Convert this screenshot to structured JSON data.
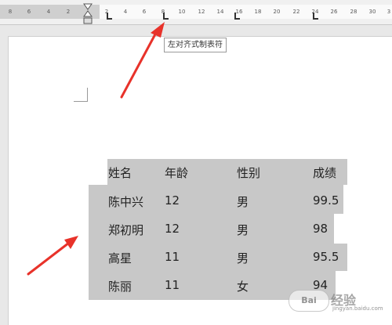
{
  "ruler": {
    "ticks": [
      "8",
      "6",
      "4",
      "2",
      "2",
      "4",
      "6",
      "8",
      "10",
      "12",
      "14",
      "16",
      "18",
      "20",
      "22",
      "24",
      "26",
      "28",
      "30",
      "3"
    ]
  },
  "tooltip": "左对齐式制表符",
  "table": {
    "headers": [
      "姓名",
      "年龄",
      "性别",
      "成绩"
    ],
    "rows": [
      [
        "陈中兴",
        "12",
        "男",
        "99.5"
      ],
      [
        "郑初明",
        "12",
        "男",
        "98"
      ],
      [
        "高星",
        "11",
        "男",
        "95.5"
      ],
      [
        "陈丽",
        "11",
        "女",
        "94"
      ]
    ]
  },
  "watermark": {
    "logo": "Bai",
    "text": "经验",
    "url": "jingyan.baidu.com"
  },
  "colors": {
    "highlight": "#c8c8c8",
    "arrow": "#e8322a"
  }
}
